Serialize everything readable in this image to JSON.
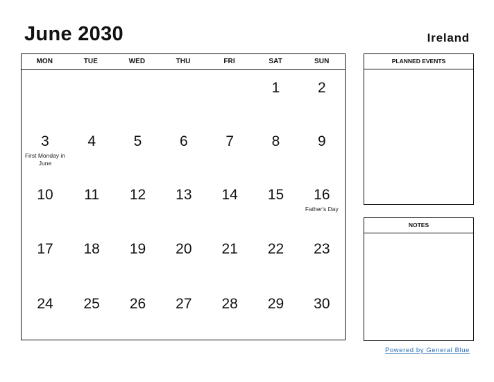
{
  "header": {
    "title": "June 2030",
    "country": "Ireland"
  },
  "calendar": {
    "weekdays": [
      "MON",
      "TUE",
      "WED",
      "THU",
      "FRI",
      "SAT",
      "SUN"
    ],
    "weeks": [
      [
        {
          "day": ""
        },
        {
          "day": ""
        },
        {
          "day": ""
        },
        {
          "day": ""
        },
        {
          "day": ""
        },
        {
          "day": "1"
        },
        {
          "day": "2"
        }
      ],
      [
        {
          "day": "3",
          "event": "First Monday in June"
        },
        {
          "day": "4"
        },
        {
          "day": "5"
        },
        {
          "day": "6"
        },
        {
          "day": "7"
        },
        {
          "day": "8"
        },
        {
          "day": "9"
        }
      ],
      [
        {
          "day": "10"
        },
        {
          "day": "11"
        },
        {
          "day": "12"
        },
        {
          "day": "13"
        },
        {
          "day": "14"
        },
        {
          "day": "15"
        },
        {
          "day": "16",
          "event": "Father's Day"
        }
      ],
      [
        {
          "day": "17"
        },
        {
          "day": "18"
        },
        {
          "day": "19"
        },
        {
          "day": "20"
        },
        {
          "day": "21"
        },
        {
          "day": "22"
        },
        {
          "day": "23"
        }
      ],
      [
        {
          "day": "24"
        },
        {
          "day": "25"
        },
        {
          "day": "26"
        },
        {
          "day": "27"
        },
        {
          "day": "28"
        },
        {
          "day": "29"
        },
        {
          "day": "30"
        }
      ]
    ]
  },
  "sidebar": {
    "planned_events_label": "PLANNED EVENTS",
    "notes_label": "NOTES"
  },
  "footer": {
    "powered_by": "Powered by General Blue",
    "link_color": "#2a6db5"
  }
}
